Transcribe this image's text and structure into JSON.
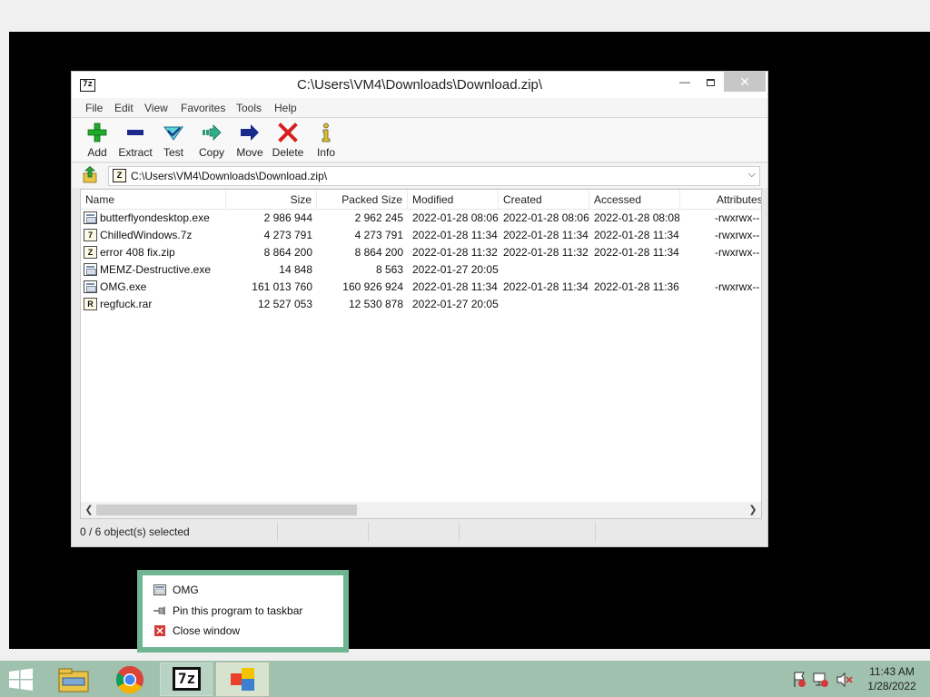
{
  "window": {
    "title": "C:\\Users\\VM4\\Downloads\\Download.zip\\",
    "app_icon_text": "7z",
    "close_glyph": "✕",
    "min_glyph": "—"
  },
  "menu": [
    "File",
    "Edit",
    "View",
    "Favorites",
    "Tools",
    "Help"
  ],
  "toolbar": {
    "add": "Add",
    "extract": "Extract",
    "test": "Test",
    "copy": "Copy",
    "move": "Move",
    "delete": "Delete",
    "info": "Info"
  },
  "address": {
    "path": "C:\\Users\\VM4\\Downloads\\Download.zip\\",
    "icon_text": "Z"
  },
  "columns": {
    "name": "Name",
    "size": "Size",
    "packed": "Packed Size",
    "modified": "Modified",
    "created": "Created",
    "accessed": "Accessed",
    "attributes": "Attributes"
  },
  "files": [
    {
      "name": "butterflyondesktop.exe",
      "icon": "exe",
      "size": "2 986 944",
      "packed": "2 962 245",
      "modified": "2022-01-28 08:06",
      "created": "2022-01-28 08:06",
      "accessed": "2022-01-28 08:08",
      "attributes": "-rwxrwx--"
    },
    {
      "name": "ChilledWindows.7z",
      "icon": "arc",
      "glyph": "7",
      "size": "4 273 791",
      "packed": "4 273 791",
      "modified": "2022-01-28 11:34",
      "created": "2022-01-28 11:34",
      "accessed": "2022-01-28 11:34",
      "attributes": "-rwxrwx--"
    },
    {
      "name": "error 408 fix.zip",
      "icon": "arc",
      "glyph": "Z",
      "size": "8 864 200",
      "packed": "8 864 200",
      "modified": "2022-01-28 11:32",
      "created": "2022-01-28 11:32",
      "accessed": "2022-01-28 11:34",
      "attributes": "-rwxrwx--"
    },
    {
      "name": "MEMZ-Destructive.exe",
      "icon": "exe",
      "size": "14 848",
      "packed": "8 563",
      "modified": "2022-01-27 20:05",
      "created": "",
      "accessed": "",
      "attributes": ""
    },
    {
      "name": "OMG.exe",
      "icon": "exe",
      "size": "161 013 760",
      "packed": "160 926 924",
      "modified": "2022-01-28 11:34",
      "created": "2022-01-28 11:34",
      "accessed": "2022-01-28 11:36",
      "attributes": "-rwxrwx--"
    },
    {
      "name": "regfuck.rar",
      "icon": "arc",
      "glyph": "R",
      "size": "12 527 053",
      "packed": "12 530 878",
      "modified": "2022-01-27 20:05",
      "created": "",
      "accessed": "",
      "attributes": ""
    }
  ],
  "status": {
    "selected": "0 / 6 object(s) selected"
  },
  "jumplist": {
    "items": [
      "OMG",
      "Pin this program to taskbar",
      "Close window"
    ]
  },
  "taskbar": {
    "time": "11:43 AM",
    "date": "1/28/2022",
    "zip_label": "7z"
  },
  "colors": {
    "taskbar": "#9fc1ae",
    "jumplist_border": "#6fb592",
    "add_green": "#1faa2a",
    "delete_red": "#d81e1e",
    "navy": "#1a2a8c"
  }
}
